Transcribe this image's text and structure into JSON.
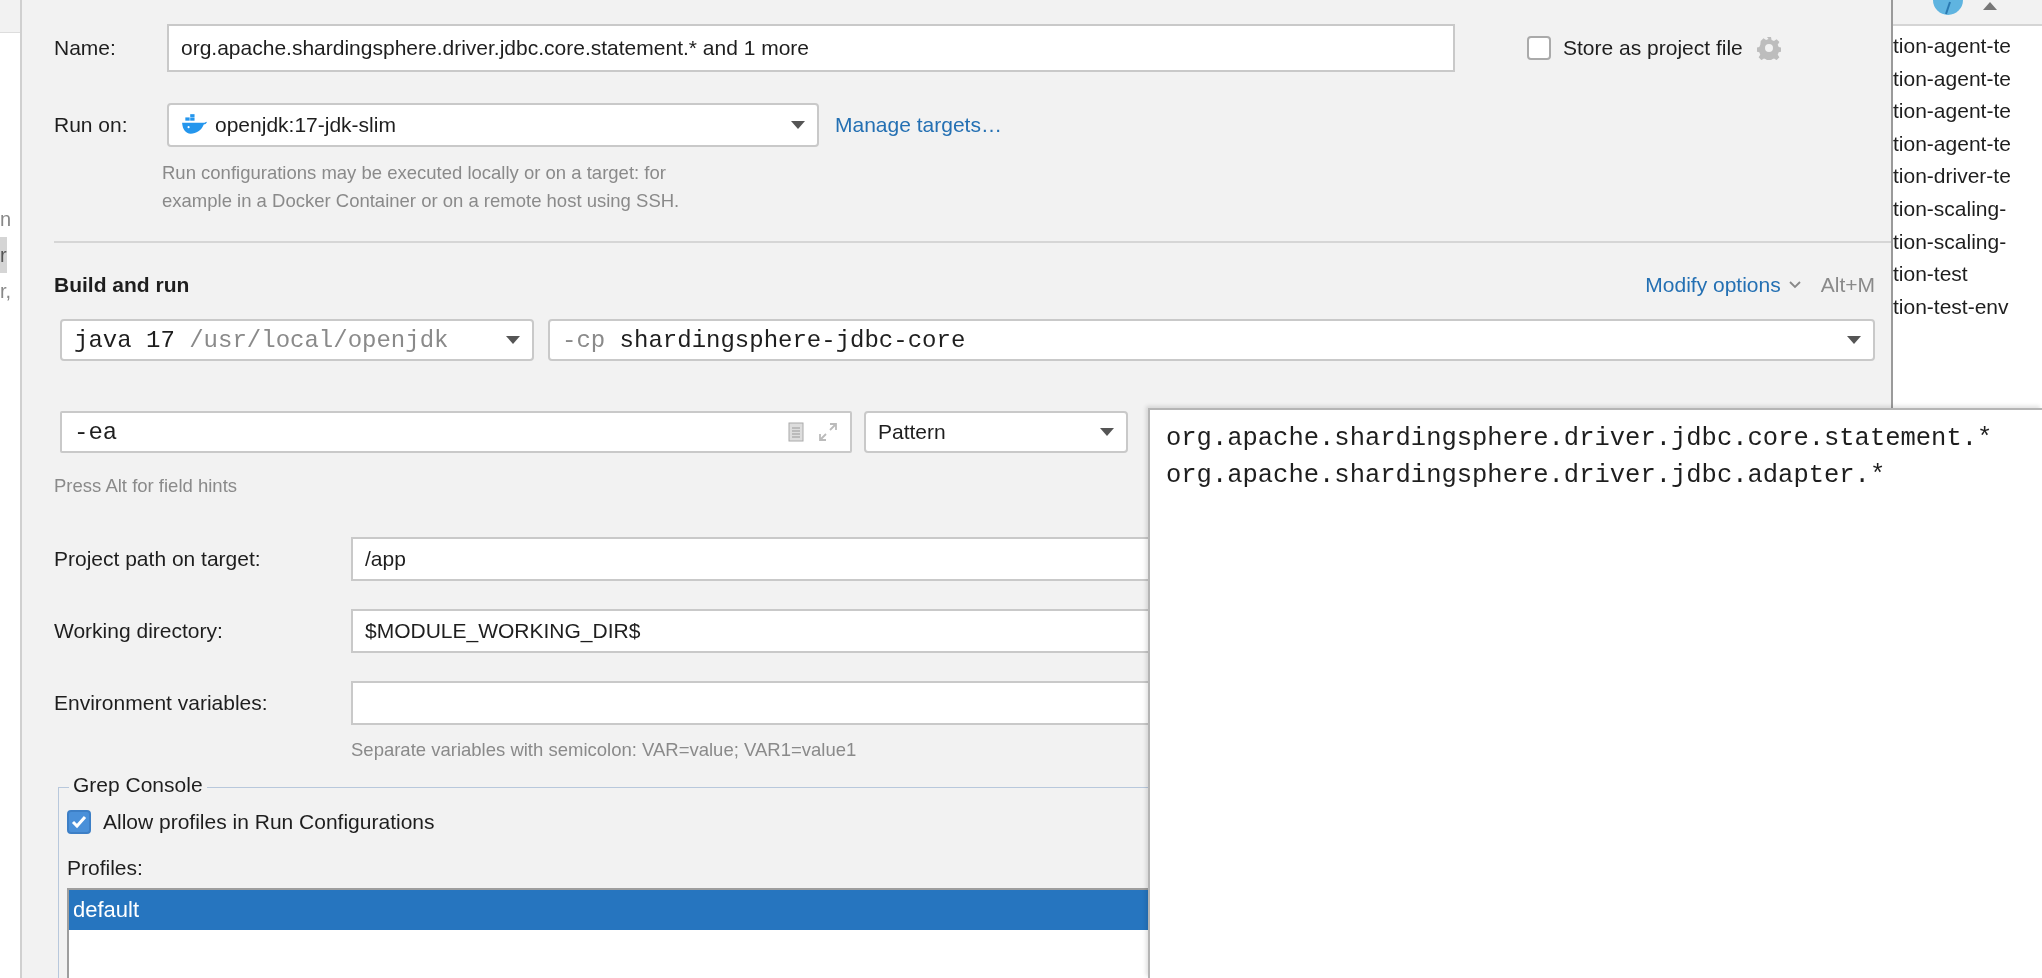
{
  "left_panel": {
    "items": [
      {
        "text": "n",
        "selected": false
      },
      {
        "text": "r",
        "selected": true
      },
      {
        "text": "r,",
        "selected": false
      }
    ]
  },
  "dialog": {
    "name": {
      "label": "Name:",
      "value": "org.apache.shardingsphere.driver.jdbc.core.statement.* and 1 more"
    },
    "store_as_project_file": {
      "label": "Store as project file",
      "checked": false
    },
    "run_on": {
      "label": "Run on:",
      "value": "openjdk:17-jdk-slim",
      "link": "Manage targets…",
      "help": [
        "Run configurations may be executed locally or on a target: for",
        "example in a Docker Container or on a remote host using SSH."
      ]
    },
    "build_and_run": {
      "title": "Build and run",
      "modify_options": "Modify options",
      "shortcut": "Alt+M",
      "jre": {
        "value": "java 17",
        "path": "/usr/local/openjdk"
      },
      "classpath": {
        "flag": "-cp",
        "value": "shardingsphere-jdbc-core"
      },
      "vm_options": {
        "value": "-ea"
      },
      "test_kind": {
        "value": "Pattern"
      },
      "hint": "Press Alt for field hints"
    },
    "fields": [
      {
        "label": "Project path on target:",
        "value": "/app"
      },
      {
        "label": "Working directory:",
        "value": "$MODULE_WORKING_DIR$"
      },
      {
        "label": "Environment variables:"
      }
    ],
    "env_hint": "Separate variables with semicolon: VAR=value; VAR1=value1",
    "grep_console": {
      "title": "Grep Console",
      "allow_profiles": {
        "label": "Allow profiles in Run Configurations",
        "checked": true
      },
      "profiles_label": "Profiles:",
      "profiles": [
        {
          "name": "default",
          "selected": true
        }
      ]
    }
  },
  "pattern_popup": {
    "lines": [
      "org.apache.shardingsphere.driver.jdbc.core.statement.*",
      "org.apache.shardingsphere.driver.jdbc.adapter.*"
    ]
  },
  "right_panel": {
    "items": [
      "tion-agent-te",
      "tion-agent-te",
      "tion-agent-te",
      "tion-agent-te",
      "tion-driver-te",
      "tion-scaling-",
      "tion-scaling-",
      "tion-test",
      "tion-test-env"
    ]
  }
}
